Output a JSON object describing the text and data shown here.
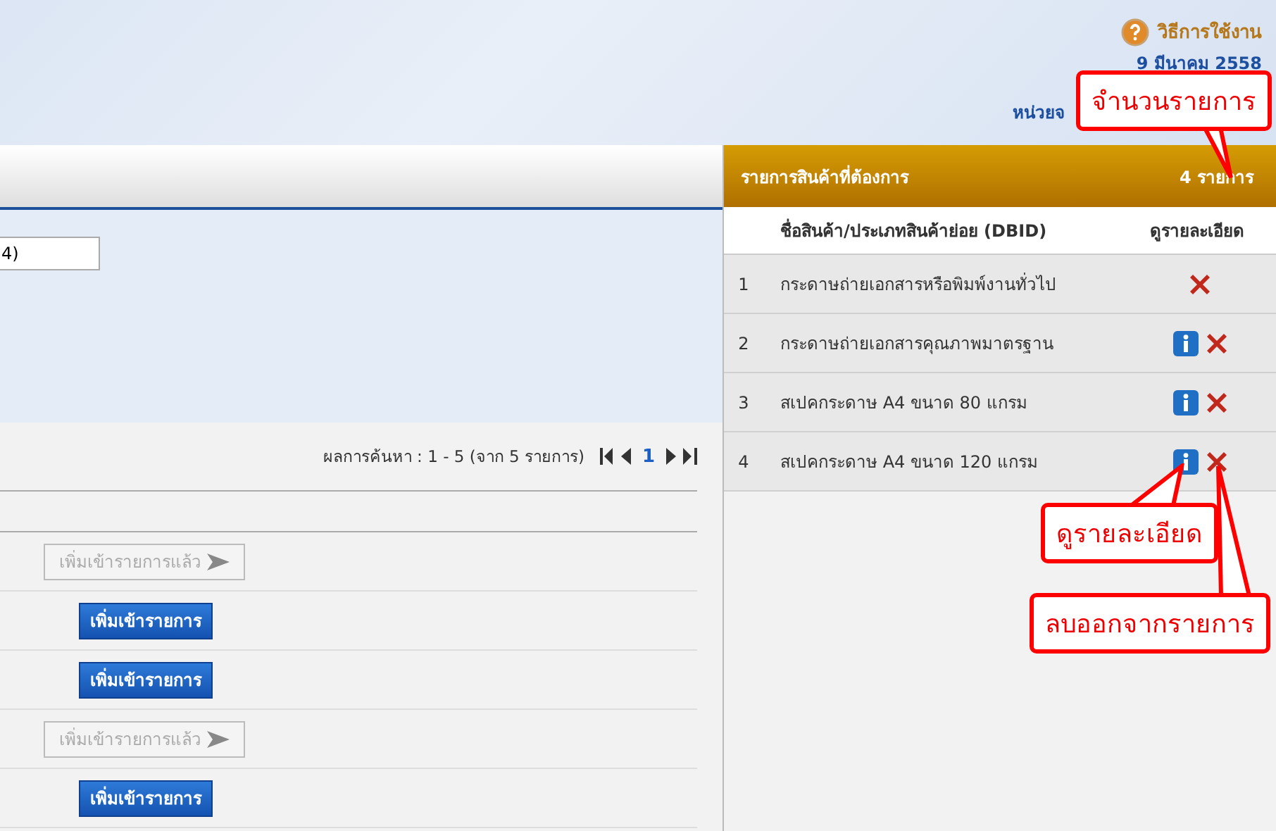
{
  "header": {
    "help_link": "วิธีการใช้งาน",
    "date": "9 มีนาคม 2558",
    "unit": "หน่วยจ"
  },
  "search_form": {
    "field_value": "4)"
  },
  "results": {
    "summary": "ผลการค้นหา :  1 - 5 (จาก 5 รายการ)",
    "page": "1",
    "rows": [
      {
        "button": "เพิ่มเข้ารายการแล้ว",
        "disabled": true
      },
      {
        "button": "เพิ่มเข้ารายการ",
        "disabled": false
      },
      {
        "button": "เพิ่มเข้ารายการ",
        "disabled": false
      },
      {
        "button": "เพิ่มเข้ารายการแล้ว",
        "disabled": true
      },
      {
        "button": "เพิ่มเข้ารายการ",
        "disabled": false
      }
    ]
  },
  "wishlist": {
    "title": "รายการสินค้าที่ต้องการ",
    "count": "4 รายการ",
    "columns": [
      "ชื่อสินค้า/ประเภทสินค้าย่อย (DBID)",
      "ดูรายละเอียด"
    ],
    "rows": [
      {
        "no": "1",
        "name": "กระดาษถ่ายเอกสารหรือพิมพ์งานทั่วไป",
        "info": false
      },
      {
        "no": "2",
        "name": "กระดาษถ่ายเอกสารคุณภาพมาตรฐาน",
        "info": true
      },
      {
        "no": "3",
        "name": "สเปคกระดาษ A4 ขนาด 80 แกรม",
        "info": true
      },
      {
        "no": "4",
        "name": "สเปคกระดาษ A4 ขนาด 120 แกรม",
        "info": true
      }
    ]
  },
  "annotations": [
    "จำนวนรายการ",
    "ดูรายละเอียด",
    "ลบออกจากรายการ"
  ]
}
